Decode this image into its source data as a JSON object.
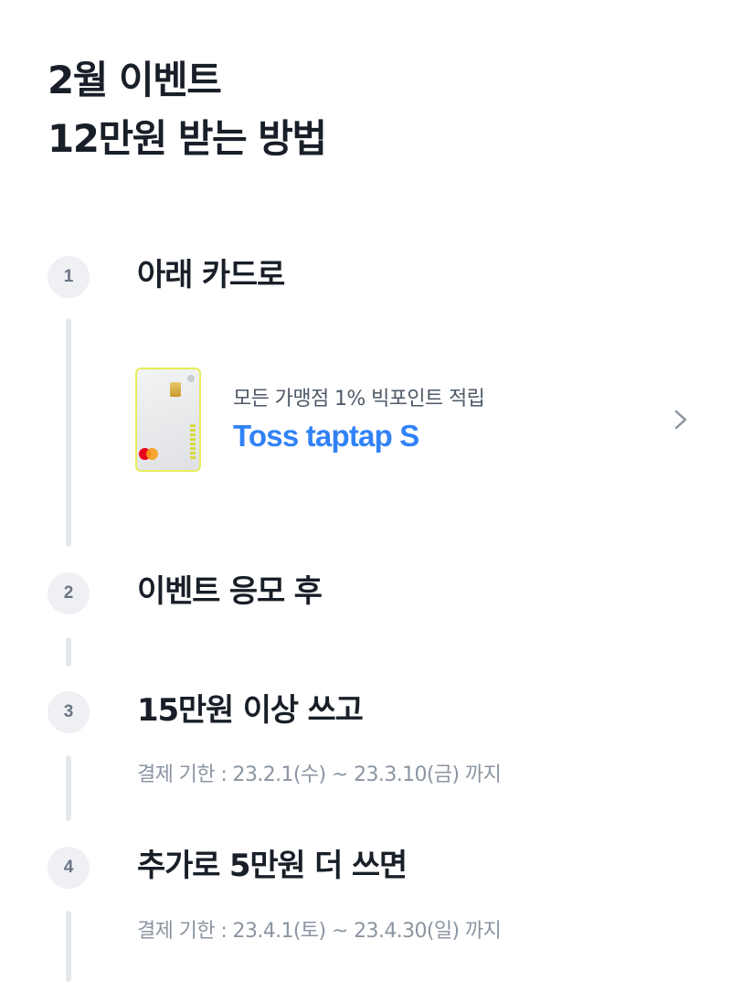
{
  "header": {
    "title_line1": "2월 이벤트",
    "title_line2": "12만원 받는 방법"
  },
  "steps": [
    {
      "number": "1",
      "title": "아래 카드로"
    },
    {
      "number": "2",
      "title": "이벤트 응모 후"
    },
    {
      "number": "3",
      "title": "15만원 이상 쓰고",
      "desc": "결제 기한 : 23.2.1(수) ~ 23.3.10(금) 까지"
    },
    {
      "number": "4",
      "title": "추가로 5만원 더 쓰면",
      "desc": "결제 기한 : 23.4.1(토) ~ 23.4.30(일) 까지"
    }
  ],
  "card": {
    "subtitle": "모든 가맹점 1% 빅포인트 적립",
    "name": "Toss taptap S",
    "icon": "chevron-right-icon"
  },
  "colors": {
    "text_primary": "#191f28",
    "text_secondary": "#8b95a1",
    "accent_blue": "#3182f6",
    "badge_bg": "#eef0f3",
    "connector": "#e5e8eb"
  }
}
